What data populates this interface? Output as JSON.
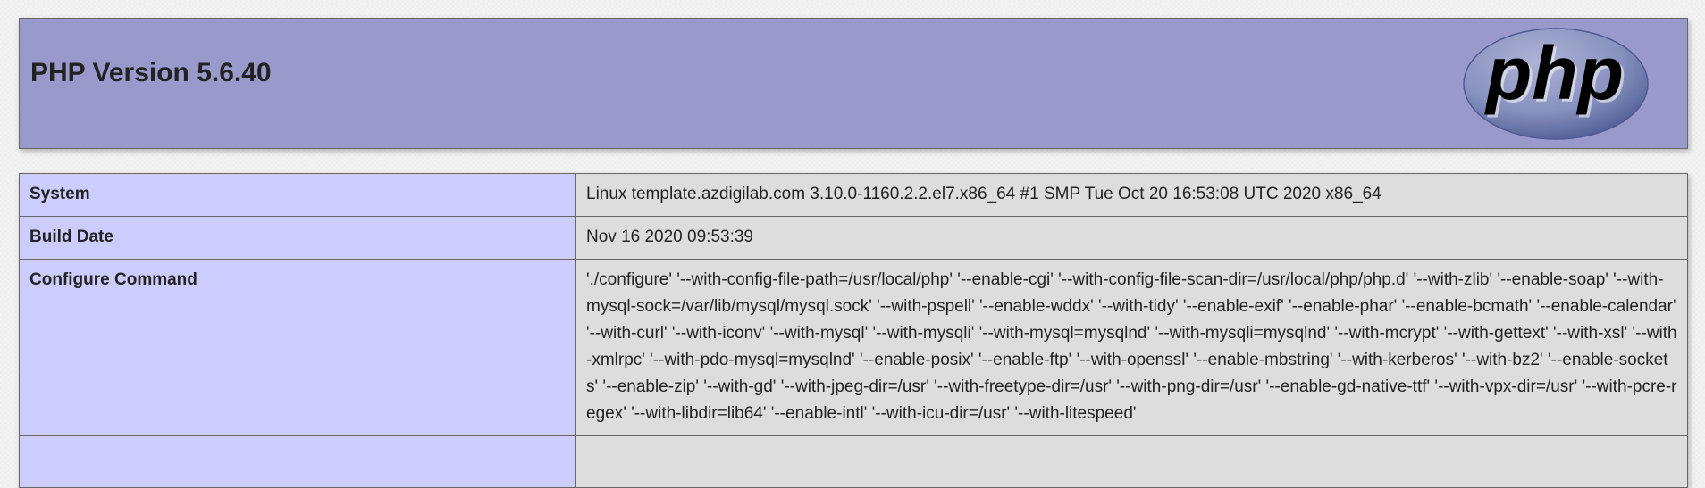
{
  "header": {
    "title": "PHP Version 5.6.40",
    "logo_text": "php",
    "logo_colors": {
      "oval": "#8892bf",
      "oval_dark": "#4f5b93",
      "text": "#000000"
    }
  },
  "rows": [
    {
      "label": "System",
      "value": "Linux template.azdigilab.com 3.10.0-1160.2.2.el7.x86_64 #1 SMP Tue Oct 20 16:53:08 UTC 2020 x86_64"
    },
    {
      "label": "Build Date",
      "value": "Nov 16 2020 09:53:39"
    },
    {
      "label": "Configure Command",
      "value": "'./configure' '--with-config-file-path=/usr/local/php' '--enable-cgi' '--with-config-file-scan-dir=/usr/local/php/php.d' '--with-zlib' '--enable-soap' '--with-mysql-sock=/var/lib/mysql/mysql.sock' '--with-pspell' '--enable-wddx' '--with-tidy' '--enable-exif' '--enable-phar' '--enable-bcmath' '--enable-calendar' '--with-curl' '--with-iconv' '--with-mysql' '--with-mysqli' '--with-mysql=mysqlnd' '--with-mysqli=mysqlnd' '--with-mcrypt' '--with-gettext' '--with-xsl' '--with-xmlrpc' '--with-pdo-mysql=mysqlnd' '--enable-posix' '--enable-ftp' '--with-openssl' '--enable-mbstring' '--with-kerberos' '--with-bz2' '--enable-sockets' '--enable-zip' '--with-gd' '--with-jpeg-dir=/usr' '--with-freetype-dir=/usr' '--with-png-dir=/usr' '--enable-gd-native-ttf' '--with-vpx-dir=/usr' '--with-pcre-regex' '--with-libdir=lib64' '--enable-intl' '--with-icu-dir=/usr' '--with-litespeed'"
    }
  ]
}
